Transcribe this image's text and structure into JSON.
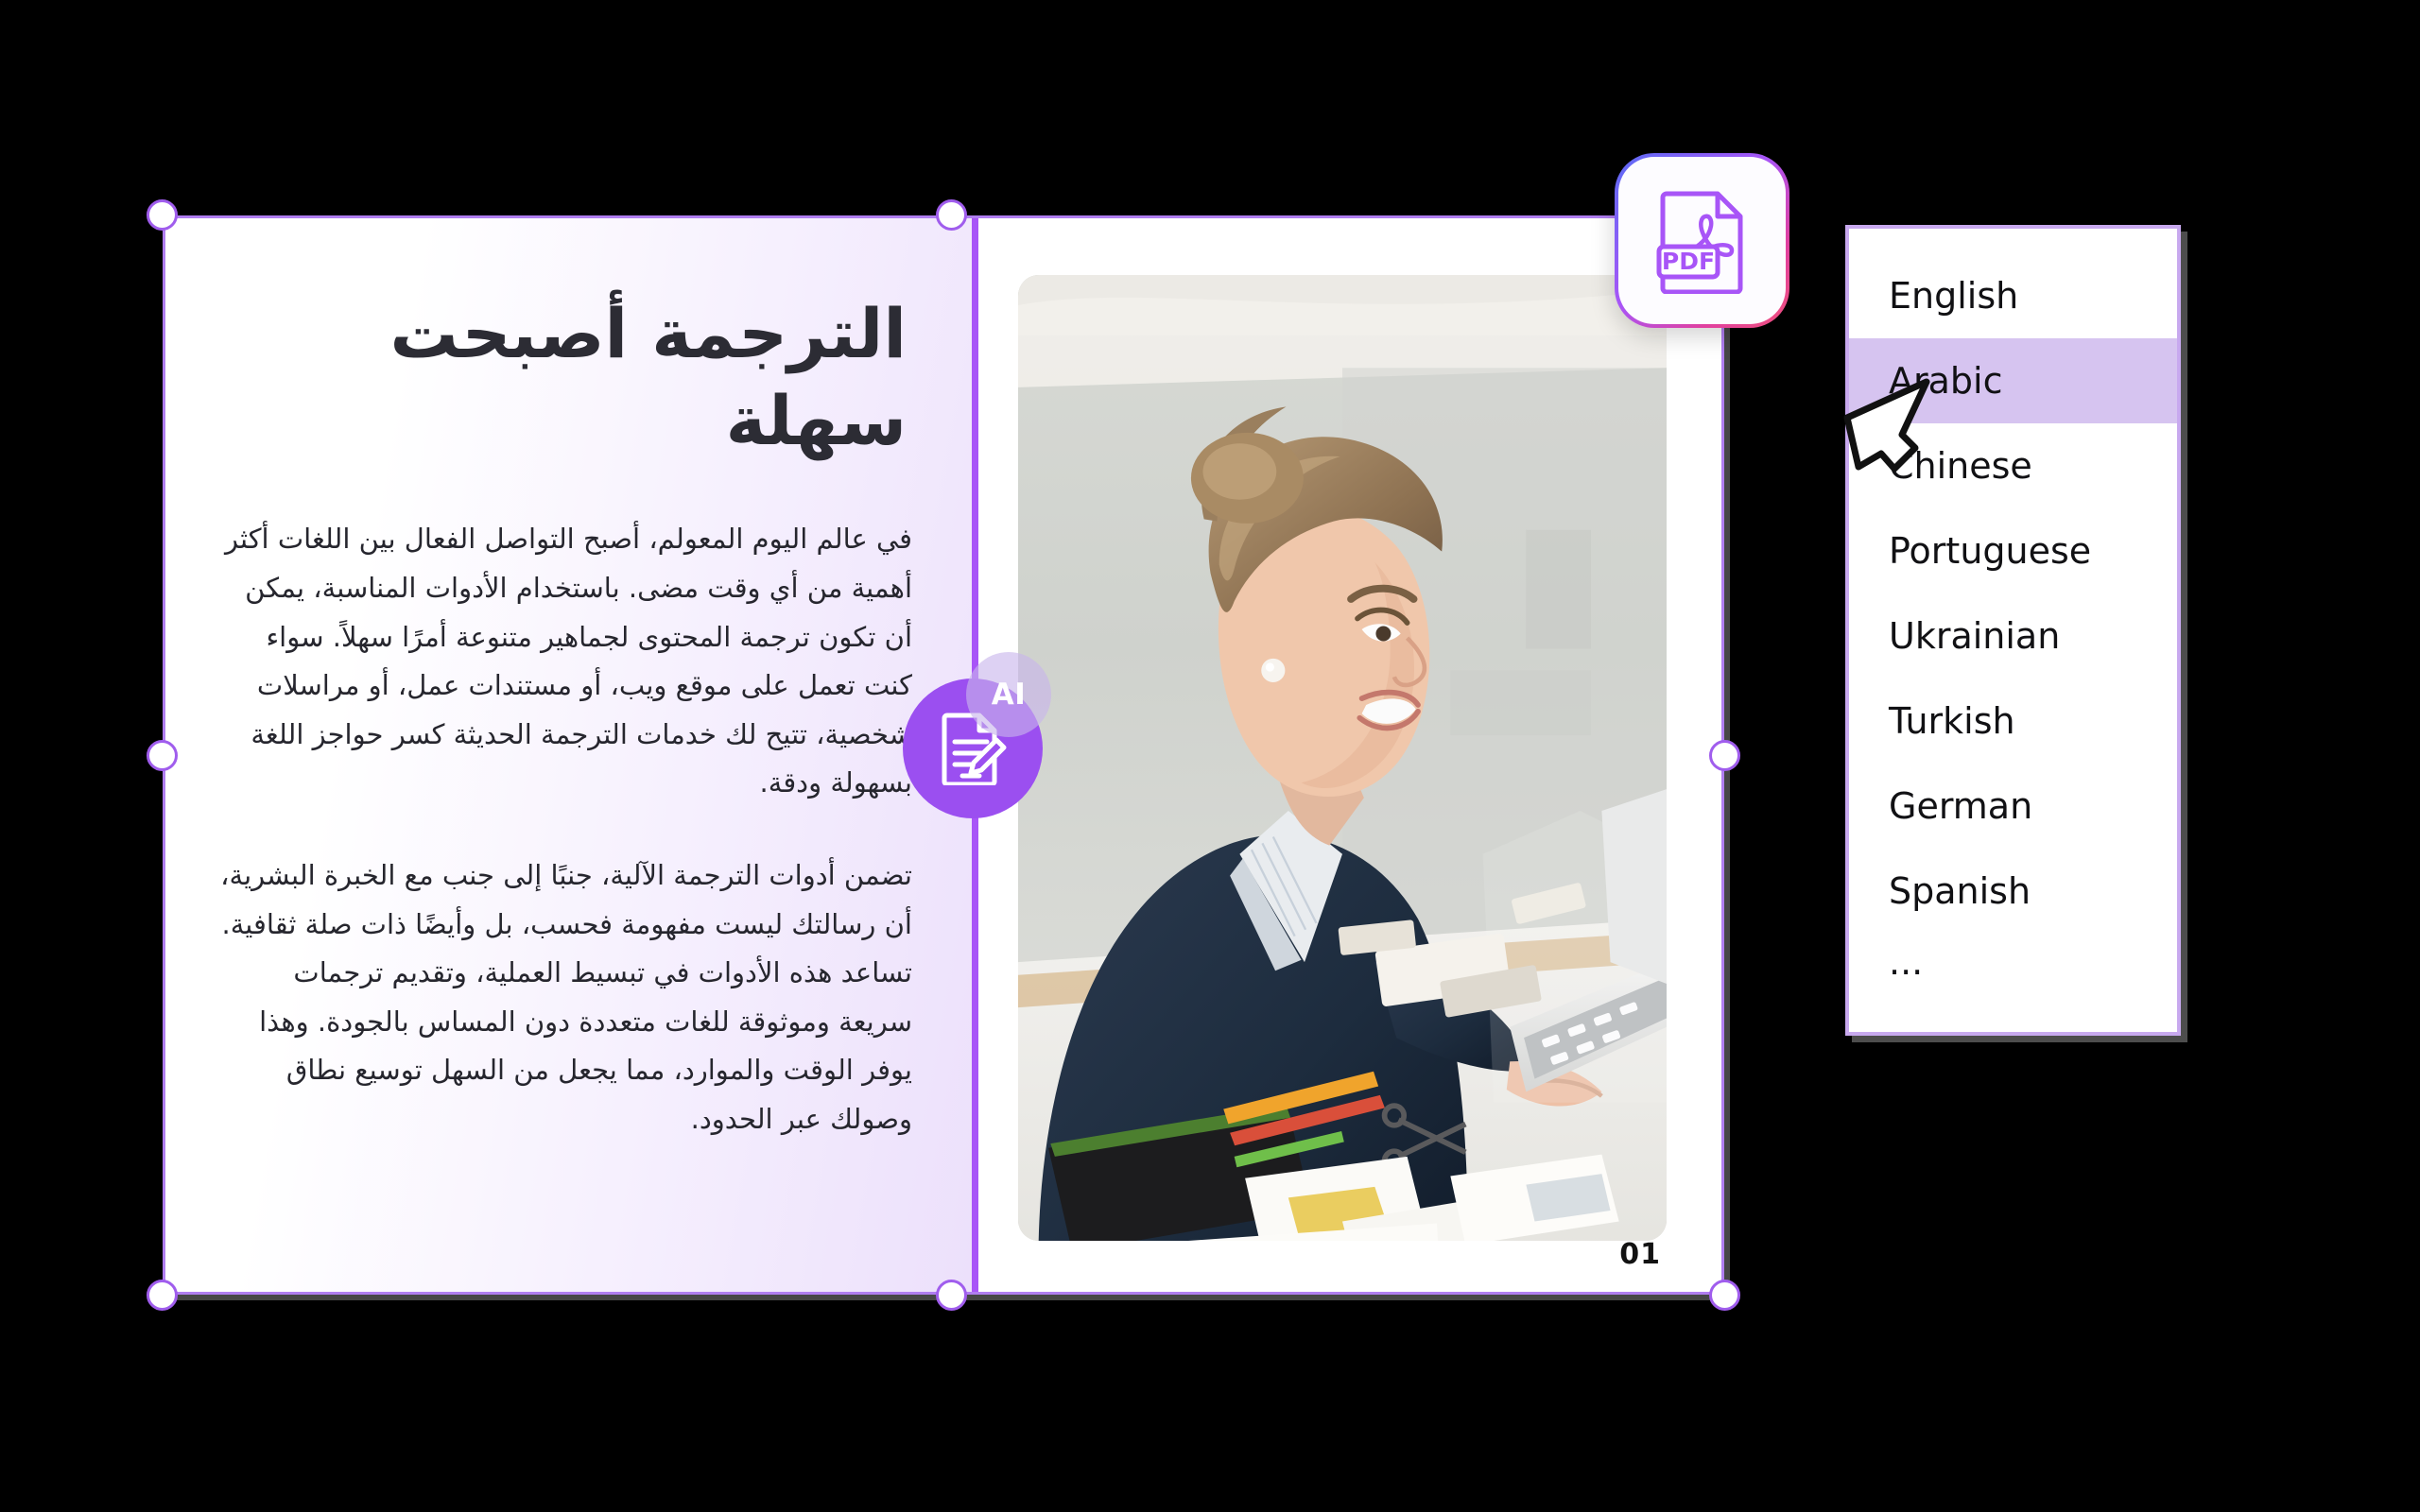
{
  "slide": {
    "headline": "الترجمة أصبحت سهلة",
    "paragraphs": [
      "في عالم اليوم المعولم، أصبح التواصل الفعال بين اللغات أكثر أهمية من أي وقت مضى. باستخدام الأدوات المناسبة، يمكن أن تكون ترجمة المحتوى لجماهير متنوعة أمرًا سهلاً. سواء كنت تعمل على موقع ويب، أو مستندات عمل، أو مراسلات شخصية، تتيح لك خدمات الترجمة الحديثة كسر حواجز اللغة بسهولة ودقة.",
      "تضمن أدوات الترجمة الآلية، جنبًا إلى جنب مع الخبرة البشرية، أن رسالتك ليست مفهومة فحسب، بل وأيضًا ذات صلة ثقافية. تساعد هذه الأدوات في تبسيط العملية، وتقديم ترجمات سريعة وموثوقة للغات متعددة دون المساس بالجودة. وهذا يوفر الوقت والموارد، مما يجعل من السهل توسيع نطاق وصولك عبر الحدود."
    ],
    "page_number": "01"
  },
  "badges": {
    "pdf_label": "PDF",
    "pdf_icon": "pdf-file-icon",
    "ai_label": "AI",
    "ai_icon": "document-edit-icon"
  },
  "language_dropdown": {
    "selected": "Arabic",
    "items": [
      {
        "label": "English",
        "selected": false
      },
      {
        "label": "Arabic",
        "selected": true
      },
      {
        "label": "Chinese",
        "selected": false
      },
      {
        "label": "Portuguese",
        "selected": false
      },
      {
        "label": "Ukrainian",
        "selected": false
      },
      {
        "label": "Turkish",
        "selected": false
      },
      {
        "label": "German",
        "selected": false
      },
      {
        "label": "Spanish",
        "selected": false
      },
      {
        "label": "...",
        "selected": false
      }
    ]
  },
  "colors": {
    "accent_purple": "#a855f7",
    "handle_border": "#a05ded",
    "selection_highlight": "#d6c4f0",
    "dropdown_border": "#c8a9ef",
    "ai_circle": "#9b4ff0",
    "panel_gradient_end": "#ece0fb",
    "canvas": "#000000"
  }
}
